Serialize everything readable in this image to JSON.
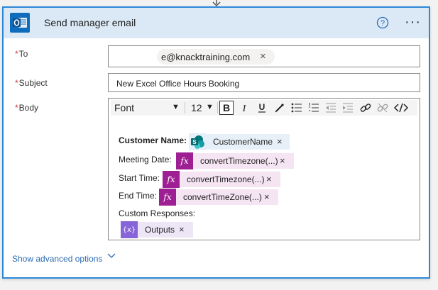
{
  "card": {
    "title": "Send manager email",
    "app_icon": "outlook-icon",
    "help_icon": "help-icon",
    "more_label": "···"
  },
  "fields": {
    "required_mark": "*",
    "to_label": "To",
    "to_value": "e@knacktraining.com",
    "to_remove": "×",
    "subject_label": "Subject",
    "subject_value": "New Excel Office Hours Booking",
    "body_label": "Body"
  },
  "toolbar": {
    "font": "Font",
    "size": "12",
    "caret": "▼",
    "buttons": [
      "bold-icon",
      "italic-icon",
      "underline-icon",
      "pen-icon",
      "bullet-list-icon",
      "numbered-list-icon",
      "outdent-icon",
      "indent-icon",
      "link-icon",
      "unlink-icon",
      "code-view-icon"
    ]
  },
  "body": {
    "lines": [
      {
        "label": "Customer Name:",
        "token": "CustomerName",
        "token_type": "sharepoint"
      },
      {
        "label": "Meeting Date:",
        "token": "convertTimezone(...)",
        "token_type": "expression"
      },
      {
        "label": "Start Time:",
        "token": "convertTimezone(...)",
        "token_type": "expression"
      },
      {
        "label": "End Time:",
        "token": "convertTimeZone(...)",
        "token_type": "expression"
      },
      {
        "label": "Custom Responses:",
        "token": "",
        "token_type": ""
      },
      {
        "label": "",
        "token": "Outputs",
        "token_type": "variable"
      }
    ],
    "fx_label": "fx",
    "var_label": "{x}",
    "remove": "×"
  },
  "advanced": {
    "label": "Show advanced options"
  },
  "colors": {
    "accent": "#2b88d8",
    "header_bg": "#dbe9f6",
    "expression": "#9e1f93",
    "expression_bg": "#f5e4f2",
    "variable": "#8764d8",
    "link": "#2b6bb3",
    "required": "#d13438"
  }
}
